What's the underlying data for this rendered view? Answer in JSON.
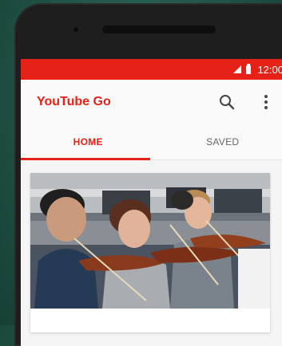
{
  "status_bar": {
    "time": "12:00"
  },
  "app_bar": {
    "title": "YouTube Go",
    "search_icon": "search-icon",
    "more_icon": "more-vert-icon"
  },
  "tabs": [
    {
      "label": "HOME",
      "active": true
    },
    {
      "label": "SAVED",
      "active": false
    }
  ],
  "colors": {
    "brand": "#e62117",
    "background": "#1f5244"
  },
  "feed": {
    "cards": [
      {
        "thumbnail": "violin-orchestra-students"
      }
    ]
  }
}
